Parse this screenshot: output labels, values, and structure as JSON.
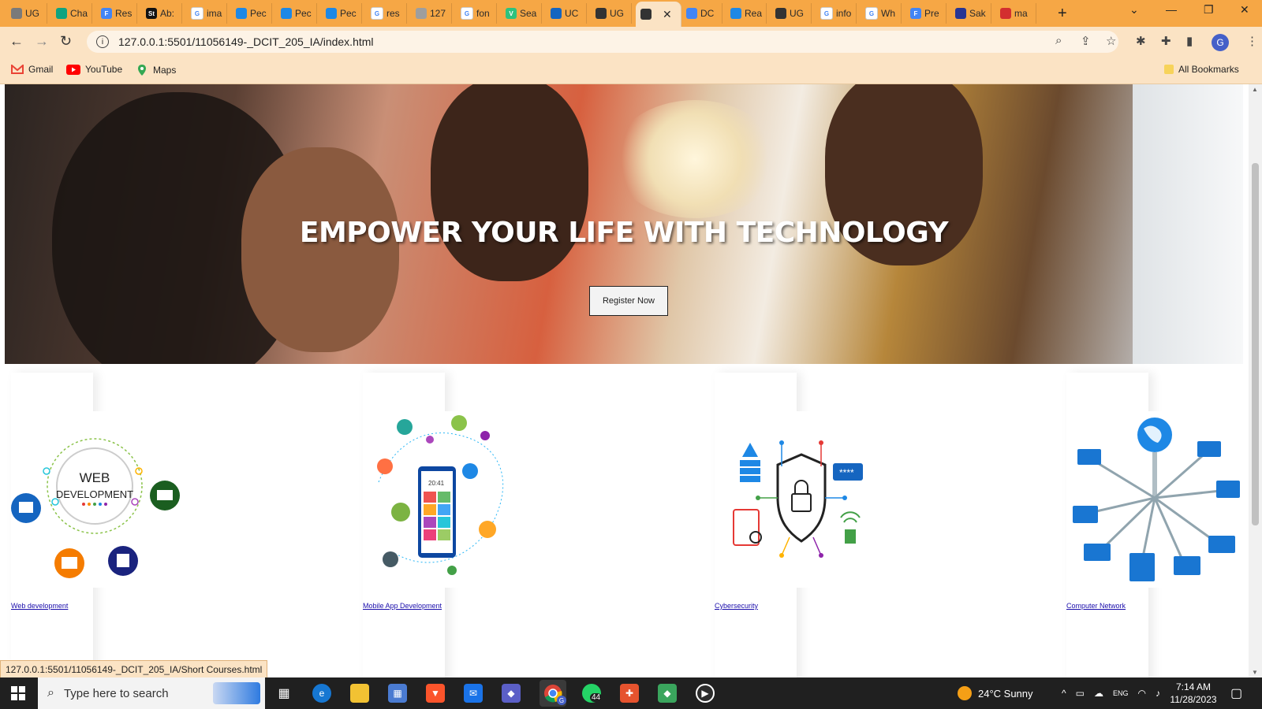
{
  "browser": {
    "tabs": [
      {
        "label": "UG",
        "color": "#7a7a7a",
        "glyph": ""
      },
      {
        "label": "Cha",
        "color": "#10a37f",
        "glyph": ""
      },
      {
        "label": "Res",
        "color": "#4285f4",
        "glyph": "F"
      },
      {
        "label": "Ab:",
        "color": "#111111",
        "glyph": "St"
      },
      {
        "label": "ima",
        "color": "#ffffff",
        "glyph": "G"
      },
      {
        "label": "Pec",
        "color": "#1e88e5",
        "glyph": ""
      },
      {
        "label": "Pec",
        "color": "#1e88e5",
        "glyph": ""
      },
      {
        "label": "Pec",
        "color": "#1e88e5",
        "glyph": ""
      },
      {
        "label": "res",
        "color": "#ffffff",
        "glyph": "G"
      },
      {
        "label": "127",
        "color": "#9e9e9e",
        "glyph": ""
      },
      {
        "label": "fon",
        "color": "#ffffff",
        "glyph": "G"
      },
      {
        "label": "Sea",
        "color": "#2ec27e",
        "glyph": "V"
      },
      {
        "label": "UC",
        "color": "#1565c0",
        "glyph": ""
      },
      {
        "label": "UG",
        "color": "#333333",
        "glyph": ""
      },
      {
        "label": "",
        "color": "#333333",
        "glyph": "",
        "active": true
      },
      {
        "label": "DC",
        "color": "#4285f4",
        "glyph": ""
      },
      {
        "label": "Rea",
        "color": "#1e88e5",
        "glyph": ""
      },
      {
        "label": "UG",
        "color": "#333333",
        "glyph": ""
      },
      {
        "label": "info",
        "color": "#ffffff",
        "glyph": "G"
      },
      {
        "label": "Wh",
        "color": "#ffffff",
        "glyph": "G"
      },
      {
        "label": "Pre",
        "color": "#4285f4",
        "glyph": "F"
      },
      {
        "label": "Sak",
        "color": "#283593",
        "glyph": ""
      },
      {
        "label": "ma",
        "color": "#d32f2f",
        "glyph": ""
      }
    ],
    "url": "127.0.0.1:5501/11056149-_DCIT_205_IA/index.html",
    "bookmarks": [
      {
        "label": "Gmail",
        "icon": "gmail-icon"
      },
      {
        "label": "YouTube",
        "icon": "youtube-icon"
      },
      {
        "label": "Maps",
        "icon": "maps-icon"
      }
    ],
    "all_bookmarks": "All Bookmarks",
    "profile_initial": "G",
    "status_url": "127.0.0.1:5501/11056149-_DCIT_205_IA/Short Courses.html"
  },
  "hero": {
    "headline": "EMPOWER YOUR LIFE WITH TECHNOLOGY",
    "button": "Register Now"
  },
  "courses": [
    {
      "label": "Web development",
      "image": "web-development-illustration",
      "caption_lines": [
        "WEB",
        "DEVELOPMENT"
      ]
    },
    {
      "label": "Mobile App Development",
      "image": "mobile-app-illustration",
      "phone_time": "20:41"
    },
    {
      "label": "Cybersecurity",
      "image": "cybersecurity-illustration",
      "password_mask": "****"
    },
    {
      "label": "Computer Network",
      "image": "computer-network-illustration"
    }
  ],
  "taskbar": {
    "search_placeholder": "Type here to search",
    "weather": "24°C  Sunny",
    "time": "7:14 AM",
    "date": "11/28/2023",
    "whatsapp_badge": "44",
    "chrome_profile_badge": "G",
    "tray_lang": "ENG"
  }
}
